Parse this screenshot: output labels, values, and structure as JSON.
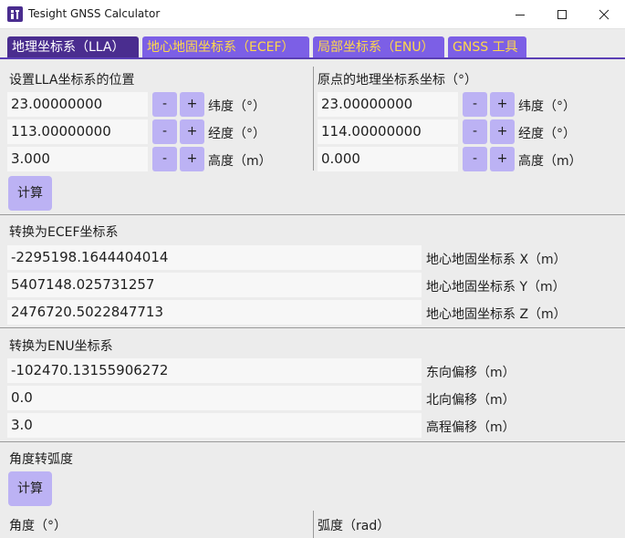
{
  "window": {
    "title": "Tesight GNSS Calculator",
    "icon": "app-icon"
  },
  "colors": {
    "tab_active_bg": "#4a2d8f",
    "tab_inactive_bg": "#7c5fe6",
    "tab_inactive_text": "#ffd84a",
    "button_bg": "#bcb2f4"
  },
  "tabs": [
    {
      "label": "地理坐标系（LLA）",
      "active": true
    },
    {
      "label": "地心地固坐标系（ECEF）",
      "active": false
    },
    {
      "label": "局部坐标系（ENU）",
      "active": false
    },
    {
      "label": "GNSS 工具",
      "active": false
    }
  ],
  "lla": {
    "title": "设置LLA坐标系的位置",
    "lat": "23.00000000",
    "lon": "113.00000000",
    "alt": "3.000",
    "lat_label": "纬度（°）",
    "lon_label": "经度（°）",
    "alt_label": "高度（m）"
  },
  "origin": {
    "title": "原点的地理坐标系坐标（°）",
    "lat": "23.00000000",
    "lon": "114.00000000",
    "alt": "0.000",
    "lat_label": "纬度（°）",
    "lon_label": "经度（°）",
    "alt_label": "高度（m）"
  },
  "stepper": {
    "minus": "-",
    "plus": "+"
  },
  "calc_button": "计算",
  "ecef": {
    "title": "转换为ECEF坐标系",
    "x": "-2295198.1644404014",
    "y": "5407148.025731257",
    "z": "2476720.5022847713",
    "x_label": "地心地固坐标系 X（m）",
    "y_label": "地心地固坐标系 Y（m）",
    "z_label": "地心地固坐标系 Z（m）"
  },
  "enu": {
    "title": "转换为ENU坐标系",
    "e": "-102470.13155906272",
    "n": "0.0",
    "u": "3.0",
    "e_label": "东向偏移（m）",
    "n_label": "北向偏移（m）",
    "u_label": "高程偏移（m）"
  },
  "angle": {
    "title": "角度转弧度",
    "calc_button": "计算",
    "degree_label": "角度（°）",
    "radian_label": "弧度（rad）"
  }
}
